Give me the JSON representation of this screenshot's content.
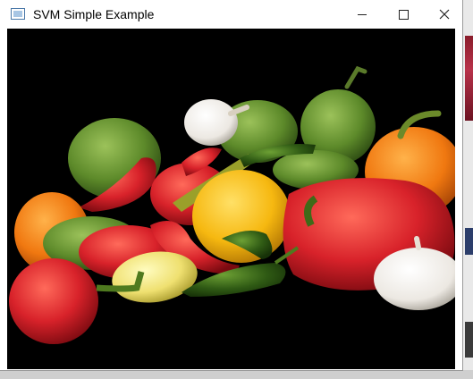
{
  "window": {
    "title": "SVM Simple Example",
    "icon": "window-app-icon",
    "controls": [
      "minimize-icon",
      "maximize-icon",
      "close-icon"
    ]
  },
  "canvas": {
    "background": "#000000",
    "content": "peppers-image"
  }
}
